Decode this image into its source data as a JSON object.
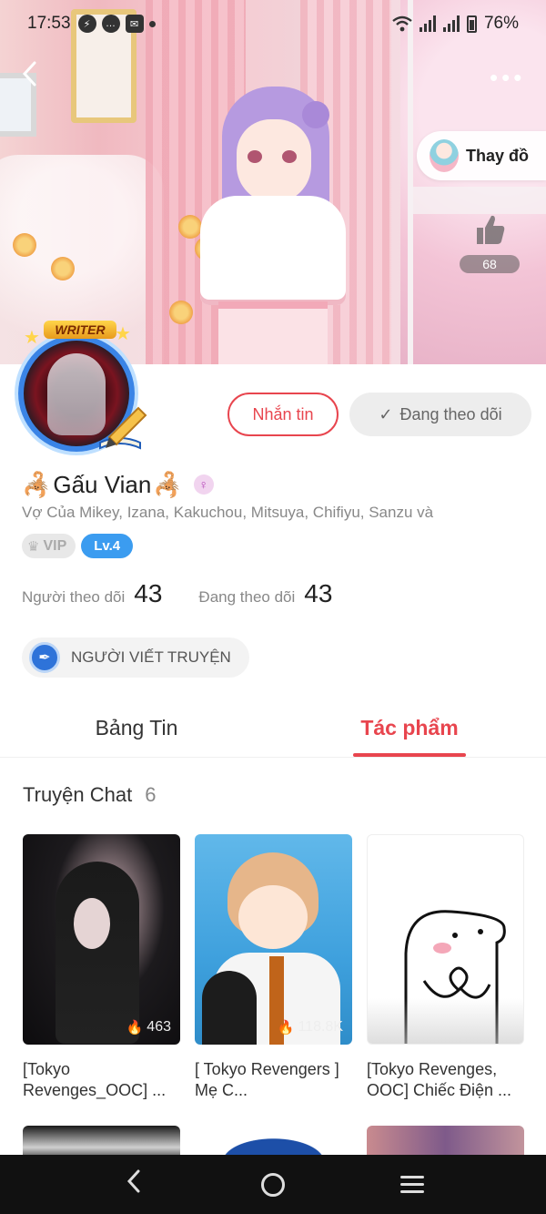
{
  "status_bar": {
    "time": "17:53",
    "battery": "76%",
    "icons": [
      "messenger-icon",
      "chat-icon",
      "mail-icon",
      "wifi-icon",
      "signal-icon",
      "battery-icon"
    ]
  },
  "header": {
    "back_icon": "chevron-left-icon",
    "more_icon": "more-dots-icon",
    "change_outfit_label": "Thay đồ",
    "like_count": "68"
  },
  "profile": {
    "writer_badge": "WRITER",
    "message_button": "Nhắn tin",
    "following_button": "Đang theo dõi",
    "name": "Gấu Vian",
    "name_decoration_left": "🦂",
    "name_decoration_right": "🦂",
    "bio": "Vợ Của Mikey, Izana, Kakuchou, Mitsuya, Chifiyu, Sanzu và",
    "vip_label": "VIP",
    "level_label": "Lv.4",
    "followers_label": "Người theo dõi",
    "followers_count": "43",
    "following_label": "Đang theo dõi",
    "following_count": "43",
    "role_label": "NGƯỜI VIẾT TRUYỆN"
  },
  "tabs": [
    {
      "label": "Bảng Tin",
      "active": false
    },
    {
      "label": "Tác phẩm",
      "active": true
    }
  ],
  "section": {
    "title": "Truyện Chat",
    "count": "6"
  },
  "stories": [
    {
      "title": "[Tokyo Revenges_OOC] ...",
      "views": "463"
    },
    {
      "title": "[ Tokyo Revengers ] Mẹ C...",
      "views": "118.8K"
    },
    {
      "title": "[Tokyo Revenges, OOC] Chiếc Điện ...",
      "views": ""
    }
  ],
  "colors": {
    "accent": "#e8454e",
    "level_badge": "#3b9cf0",
    "role_icon": "#2e73d9"
  }
}
